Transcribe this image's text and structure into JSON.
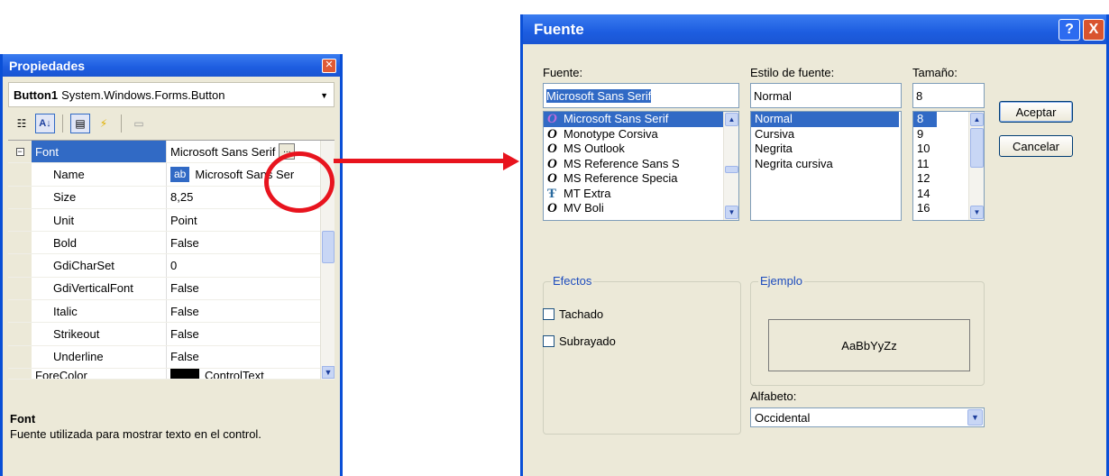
{
  "properties_panel": {
    "title": "Propiedades",
    "object_name": "Button1",
    "object_type": "System.Windows.Forms.Button",
    "toolbar": {
      "categorized_icon": "categorized-icon",
      "alphabetical_icon": "alphabetical-icon",
      "properties_icon": "properties-icon",
      "events_icon": "events-icon",
      "property_pages_icon": "property-pages-icon"
    },
    "rows": [
      {
        "name": "Font",
        "value": "Microsoft Sans Serif"
      },
      {
        "name": "Name",
        "value": "Microsoft Sans Ser"
      },
      {
        "name": "Size",
        "value": "8,25"
      },
      {
        "name": "Unit",
        "value": "Point"
      },
      {
        "name": "Bold",
        "value": "False"
      },
      {
        "name": "GdiCharSet",
        "value": "0"
      },
      {
        "name": "GdiVerticalFont",
        "value": "False"
      },
      {
        "name": "Italic",
        "value": "False"
      },
      {
        "name": "Strikeout",
        "value": "False"
      },
      {
        "name": "Underline",
        "value": "False"
      },
      {
        "name": "ForeColor",
        "value": "ControlText"
      }
    ],
    "font_name_chip": "ab",
    "ellipsis": "...",
    "description_title": "Font",
    "description_text": "Fuente utilizada para mostrar texto en el control."
  },
  "font_dialog": {
    "title": "Fuente",
    "help_label": "?",
    "close_label": "X",
    "font_label": "Fuente:",
    "style_label": "Estilo de fuente:",
    "size_label": "Tamaño:",
    "font_value": "Microsoft Sans Serif",
    "style_value": "Normal",
    "size_value": "8",
    "fonts": [
      "Microsoft Sans Serif",
      "Monotype Corsiva",
      "MS Outlook",
      "MS Reference Sans S",
      "MS Reference Specia",
      "MT Extra",
      "MV Boli"
    ],
    "styles": [
      "Normal",
      "Cursiva",
      "Negrita",
      "Negrita cursiva"
    ],
    "sizes": [
      "8",
      "9",
      "10",
      "11",
      "12",
      "14",
      "16"
    ],
    "ok_button": "Aceptar",
    "cancel_button": "Cancelar",
    "effects_label": "Efectos",
    "strikeout_label": "Tachado",
    "underline_label": "Subrayado",
    "sample_label": "Ejemplo",
    "sample_text": "AaBbYyZz",
    "script_label": "Alfabeto:",
    "script_value": "Occidental"
  },
  "colors": {
    "xp_title_blue": "#0a4fd6",
    "selection_blue": "#316ac5",
    "annotation_red": "#e8141e",
    "dialog_face": "#ece9d8"
  }
}
